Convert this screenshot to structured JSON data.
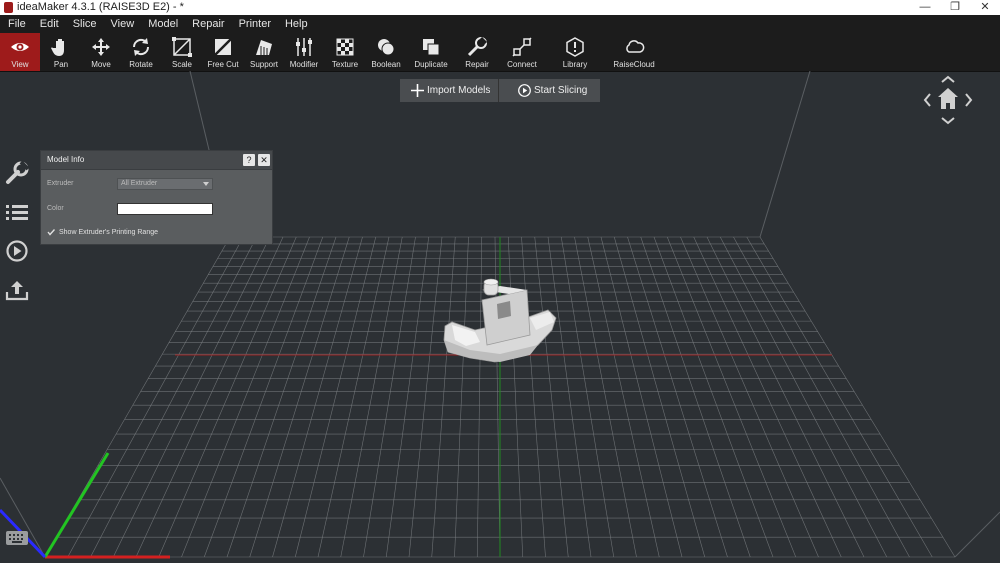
{
  "window": {
    "title": "ideaMaker 4.3.1 (RAISE3D E2) - *",
    "minimize_glyph": "—",
    "maximize_glyph": "❐",
    "close_glyph": "✕"
  },
  "menu": [
    "File",
    "Edit",
    "Slice",
    "View",
    "Model",
    "Repair",
    "Printer",
    "Help"
  ],
  "toolbar": [
    {
      "label": "View",
      "icon": "eye-icon",
      "active": true
    },
    {
      "label": "Pan",
      "icon": "hand-icon"
    },
    {
      "label": "Move",
      "icon": "move-arrows-icon"
    },
    {
      "label": "Rotate",
      "icon": "rotate-icon"
    },
    {
      "label": "Scale",
      "icon": "scale-icon"
    },
    {
      "label": "Free Cut",
      "icon": "free-cut-icon"
    },
    {
      "label": "Support",
      "icon": "support-icon"
    },
    {
      "label": "Modifier",
      "icon": "modifier-icon"
    },
    {
      "label": "Texture",
      "icon": "texture-icon"
    },
    {
      "label": "Boolean",
      "icon": "boolean-icon"
    },
    {
      "label": "Duplicate",
      "icon": "duplicate-icon"
    },
    {
      "label": "Repair",
      "icon": "repair-icon"
    },
    {
      "label": "Connect",
      "icon": "connect-icon"
    },
    {
      "label": "Library",
      "icon": "library-icon"
    },
    {
      "label": "RaiseCloud",
      "icon": "cloud-icon"
    }
  ],
  "actions": {
    "import_label": "Import Models",
    "slice_label": "Start Slicing"
  },
  "model_info": {
    "title": "Model Info",
    "help_glyph": "?",
    "close_glyph": "✕",
    "extruder_label": "Extruder",
    "extruder_value": "All Extruder",
    "color_label": "Color",
    "color_value": "#ffffff",
    "show_range_label": "Show Extruder's Printing Range",
    "show_range_checked": true
  },
  "side_icons": [
    "wrench-icon",
    "list-icon",
    "play-icon",
    "upload-icon"
  ],
  "colors": {
    "accent": "#9e1b1b",
    "background": "#2c3034",
    "grid": "#7d8184",
    "x_axis": "#d42020",
    "y_axis": "#22c422",
    "z_axis": "#2a2aff"
  }
}
